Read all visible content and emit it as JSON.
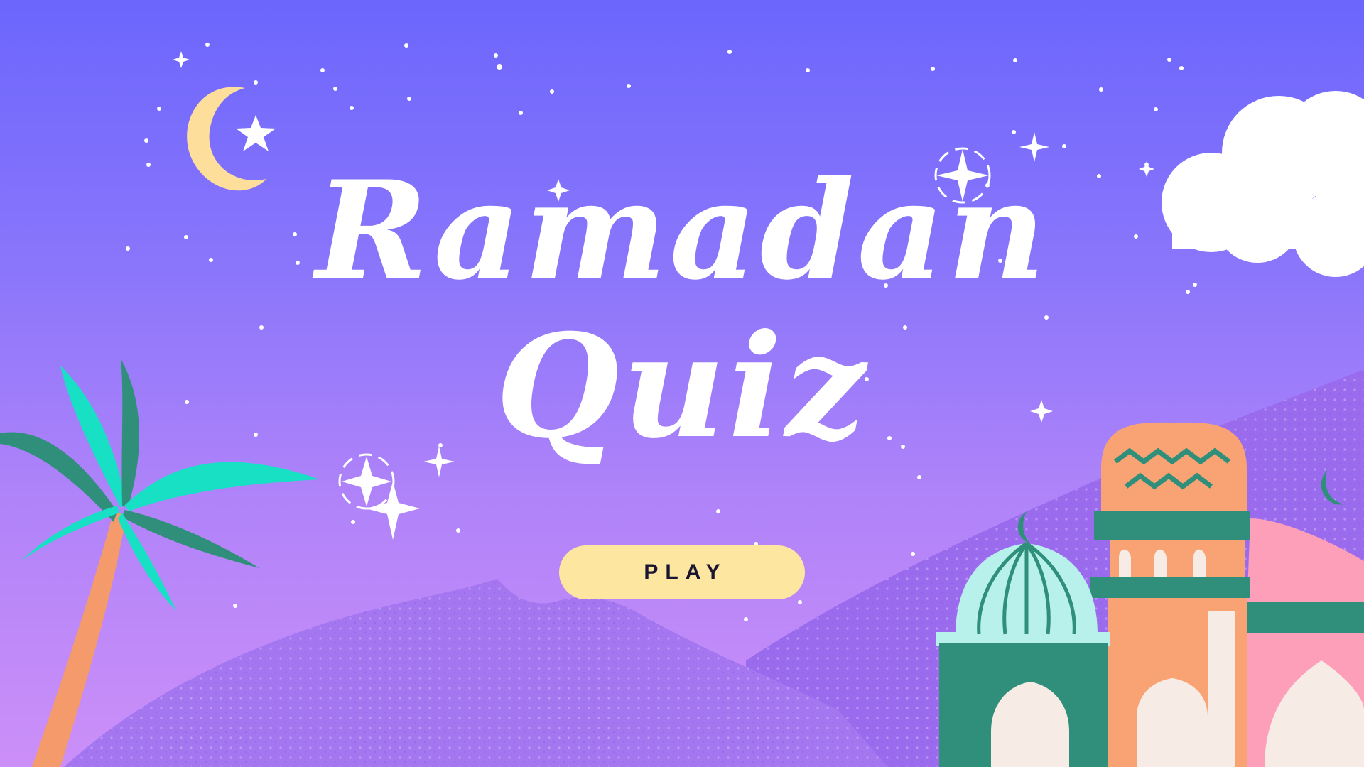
{
  "title": {
    "line1": "Ramadan",
    "line2": "Quiz"
  },
  "play_button": {
    "label": "PLAY"
  },
  "icons": [
    "crescent-moon-icon",
    "star-icon",
    "sparkle-icon",
    "cloud-icon",
    "palm-tree-icon",
    "mosque-icon"
  ],
  "colors": {
    "sky_top": "#6c66fd",
    "sky_bottom": "#cc8ff8",
    "play_button_bg": "#fde7a0",
    "moon": "#fddf9b",
    "mountain": "#a476f0",
    "palm_leaf": "#17e0c5",
    "palm_leaf_dark": "#2f8f7a",
    "palm_trunk": "#f59a6a",
    "dome_mint": "#b8f0ec",
    "mosque_green": "#2f8f7a",
    "tower_orange": "#f9a374",
    "dome_pink": "#fd9fb8"
  }
}
